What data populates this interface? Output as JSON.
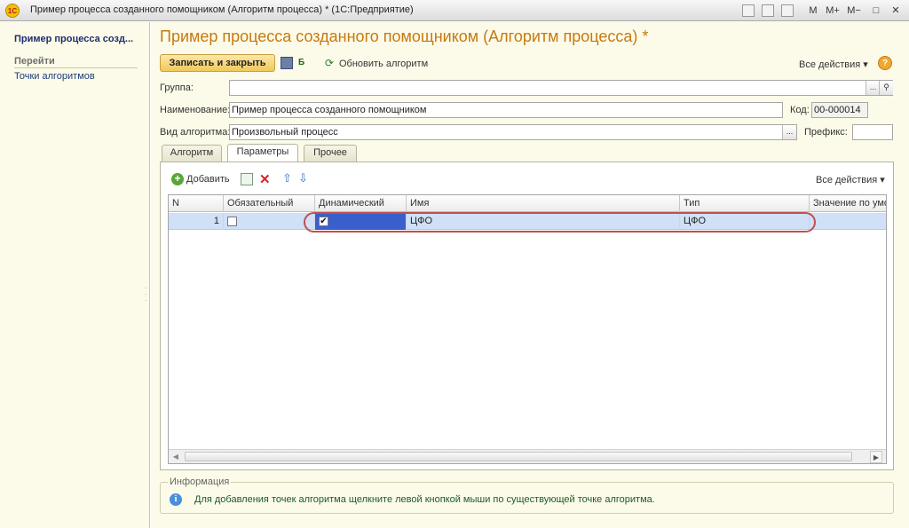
{
  "window": {
    "app_logo": "1C",
    "title": "Пример процесса созданного помощником (Алгоритм процесса) *  (1С:Предприятие)",
    "toolbar": [
      "M",
      "M+",
      "M−"
    ]
  },
  "sidebar": {
    "title": "Пример процесса созд...",
    "section": "Перейти",
    "items": [
      "Точки алгоритмов"
    ]
  },
  "form": {
    "title": "Пример процесса созданного помощником (Алгоритм процесса) *",
    "toolbar": {
      "save_close": "Записать и закрыть",
      "refresh": "Обновить алгоритм",
      "all_actions": "Все действия ▾",
      "help": "?"
    },
    "fields": {
      "group": {
        "label": "Группа:",
        "value": ""
      },
      "name": {
        "label": "Наименование:",
        "value": "Пример процесса созданного помощником"
      },
      "code": {
        "label": "Код:",
        "value": "00-000014"
      },
      "type": {
        "label": "Вид алгоритма:",
        "value": "Произвольный процесс"
      },
      "prefix": {
        "label": "Префикс:",
        "value": ""
      }
    },
    "tabs": [
      "Алгоритм",
      "Параметры",
      "Прочее"
    ],
    "active_tab": "Параметры",
    "table": {
      "add_label": "Добавить",
      "all_actions": "Все действия ▾",
      "columns": [
        "N",
        "Обязательный",
        "Динамический",
        "Имя",
        "Тип",
        "Значение по умо"
      ],
      "rows": [
        {
          "n": "1",
          "required": false,
          "dynamic": true,
          "name": "ЦФО",
          "type": "ЦФО",
          "default": ""
        }
      ]
    },
    "info": {
      "title": "Информация",
      "text": "Для добавления точек алгоритма щелкните левой кнопкой мыши по существующей точке алгоритма."
    }
  },
  "colors": {
    "title": "#c7790f",
    "panel_bg": "#fcfbe9",
    "selected_row": "#cfe0f7",
    "selected_cell": "#3a5fcd",
    "highlight": "#c0504d"
  }
}
